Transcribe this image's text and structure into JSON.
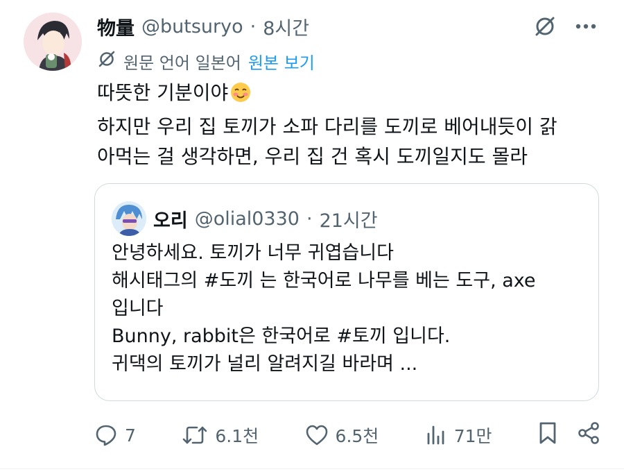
{
  "post": {
    "display_name": "物量",
    "handle": "@butsuryo",
    "separator": "·",
    "time": "8시간",
    "translate": {
      "text": "원문 언어 일본어",
      "link": "원본 보기"
    },
    "text_lines": [
      "따뜻한 기분이야",
      "하지만 우리 집 토끼가 소파 다리를 도끼로 베어내듯이 갉",
      "아먹는 걸 생각하면, 우리 집 건 혹시 도끼일지도 몰라"
    ]
  },
  "quote": {
    "display_name": "오리",
    "handle": "@olial0330",
    "separator": "·",
    "time": "21시간",
    "text_lines": [
      "안녕하세요. 토끼가 너무 귀엽습니다",
      "해시태그의 #도끼  는 한국어로 나무를 베는 도구, axe",
      "입니다",
      "Bunny, rabbit은 한국어로 #토끼 입니다.",
      "귀댁의 토끼가 널리 알려지길 바라며 ..."
    ]
  },
  "actions": {
    "replies": "7",
    "reposts": "6.1천",
    "likes": "6.5천",
    "views": "71만"
  },
  "icons": {
    "top": [
      "grok-icon",
      "more-icon"
    ],
    "actions": [
      "reply-icon",
      "repost-icon",
      "like-icon",
      "views-icon",
      "bookmark-icon",
      "share-icon"
    ]
  },
  "colors": {
    "text": "#0f1419",
    "secondary": "#536471",
    "link": "#1d9bf0",
    "border": "#cfd9de"
  }
}
